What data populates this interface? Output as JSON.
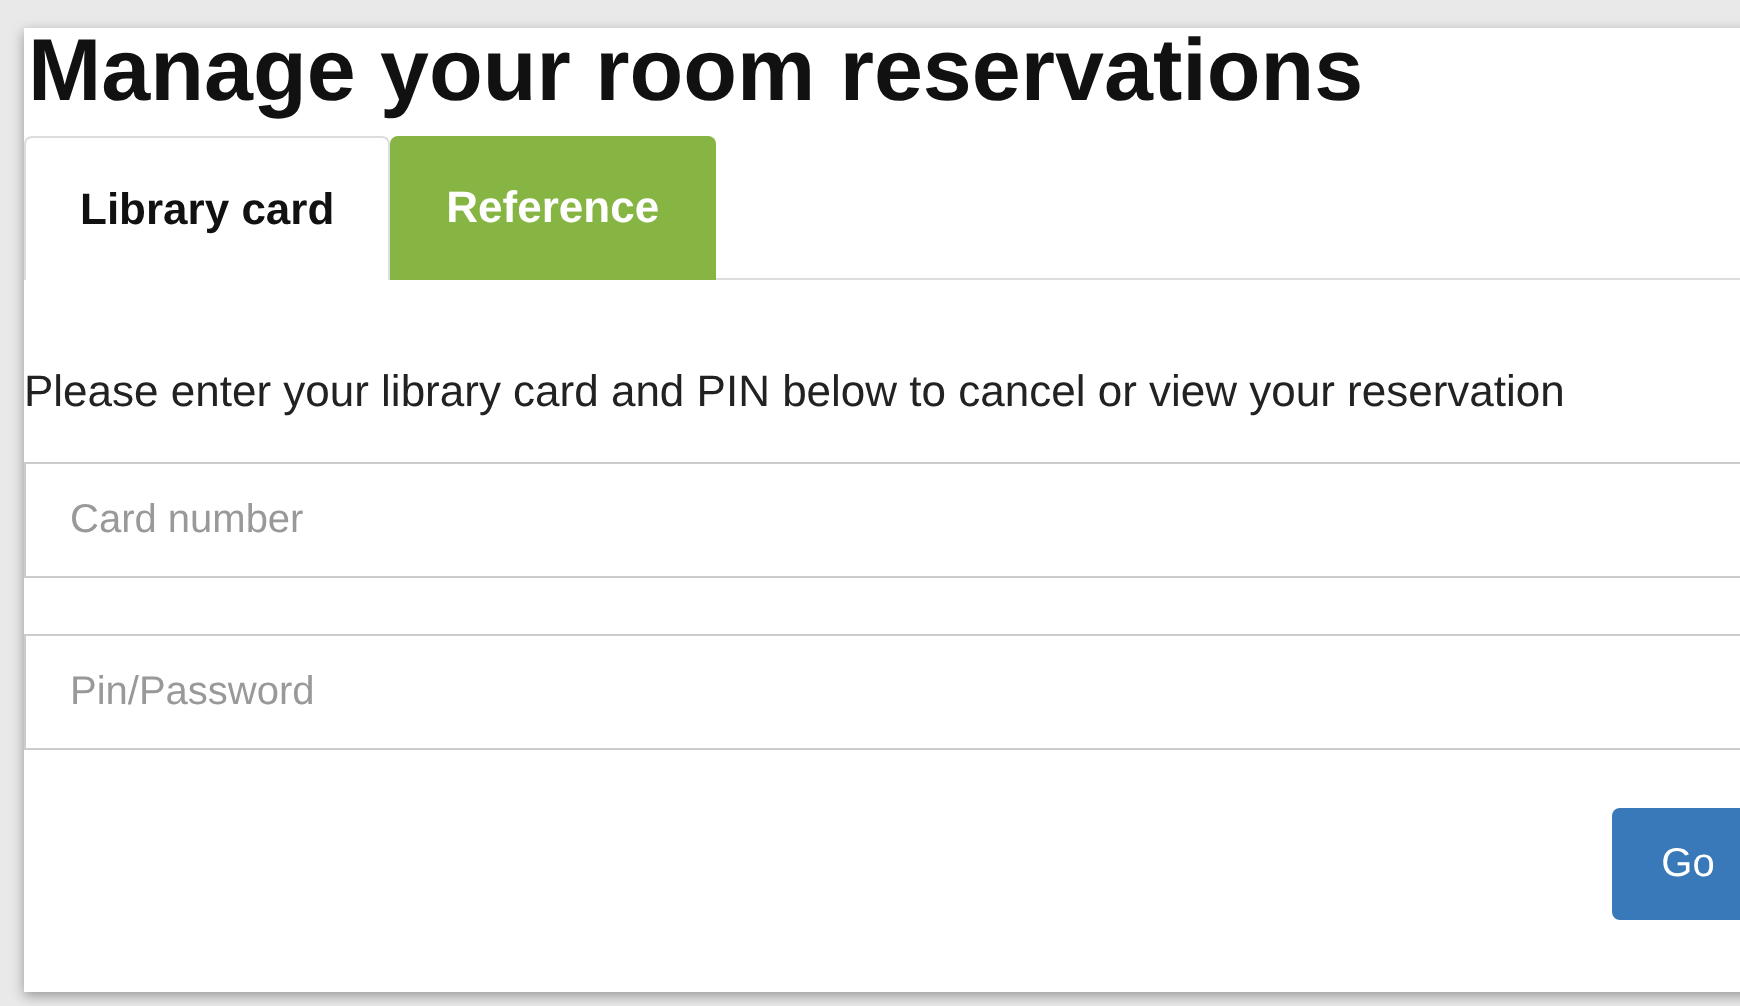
{
  "title": "Manage your room reservations",
  "tabs": [
    {
      "label": "Library card",
      "selected": true
    },
    {
      "label": "Reference",
      "selected": false
    }
  ],
  "instructions": "Please enter your library card and PIN below to cancel or view your reservation",
  "fields": [
    {
      "placeholder": "Card number"
    },
    {
      "placeholder": "Pin/Password"
    }
  ],
  "submit": "Go"
}
